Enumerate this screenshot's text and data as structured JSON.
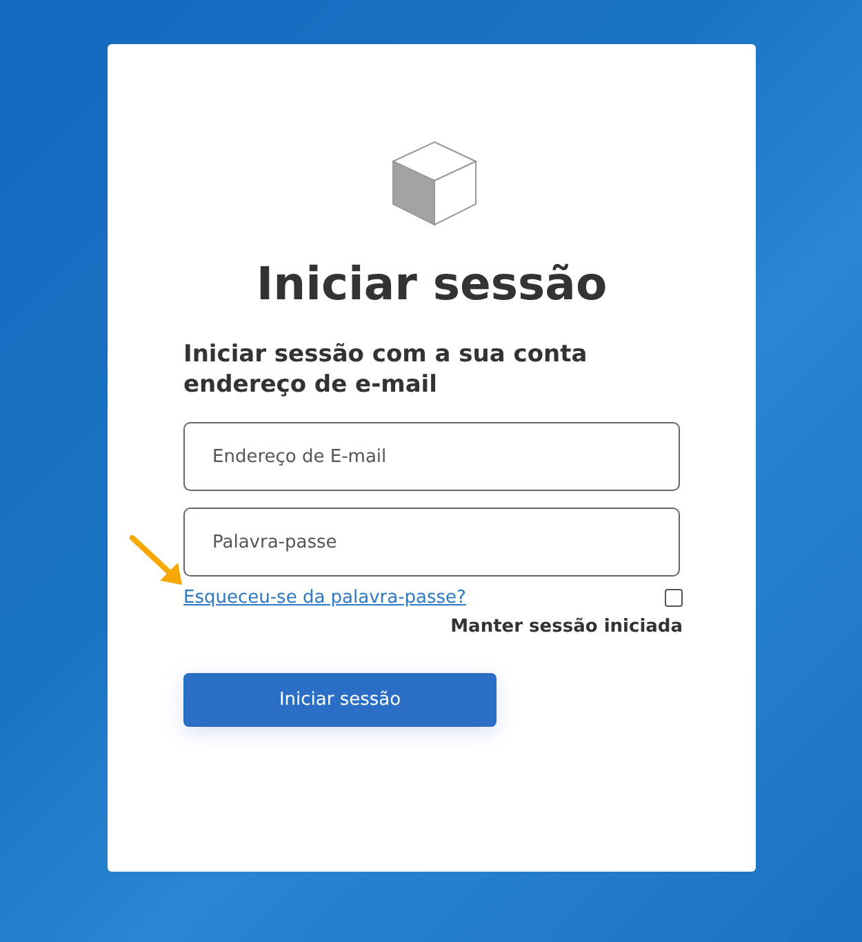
{
  "title": "Iniciar sessão",
  "subtitle": "Iniciar sessão com a sua conta endereço de e-mail",
  "fields": [
    {
      "placeholder": "Endereço de E-mail"
    },
    {
      "placeholder": "Palavra-passe"
    }
  ],
  "forgot_link": "Esqueceu-se da palavra-passe?",
  "remember": {
    "label": "Manter sessão iniciada",
    "checked": false
  },
  "submit": "Iniciar sessão"
}
